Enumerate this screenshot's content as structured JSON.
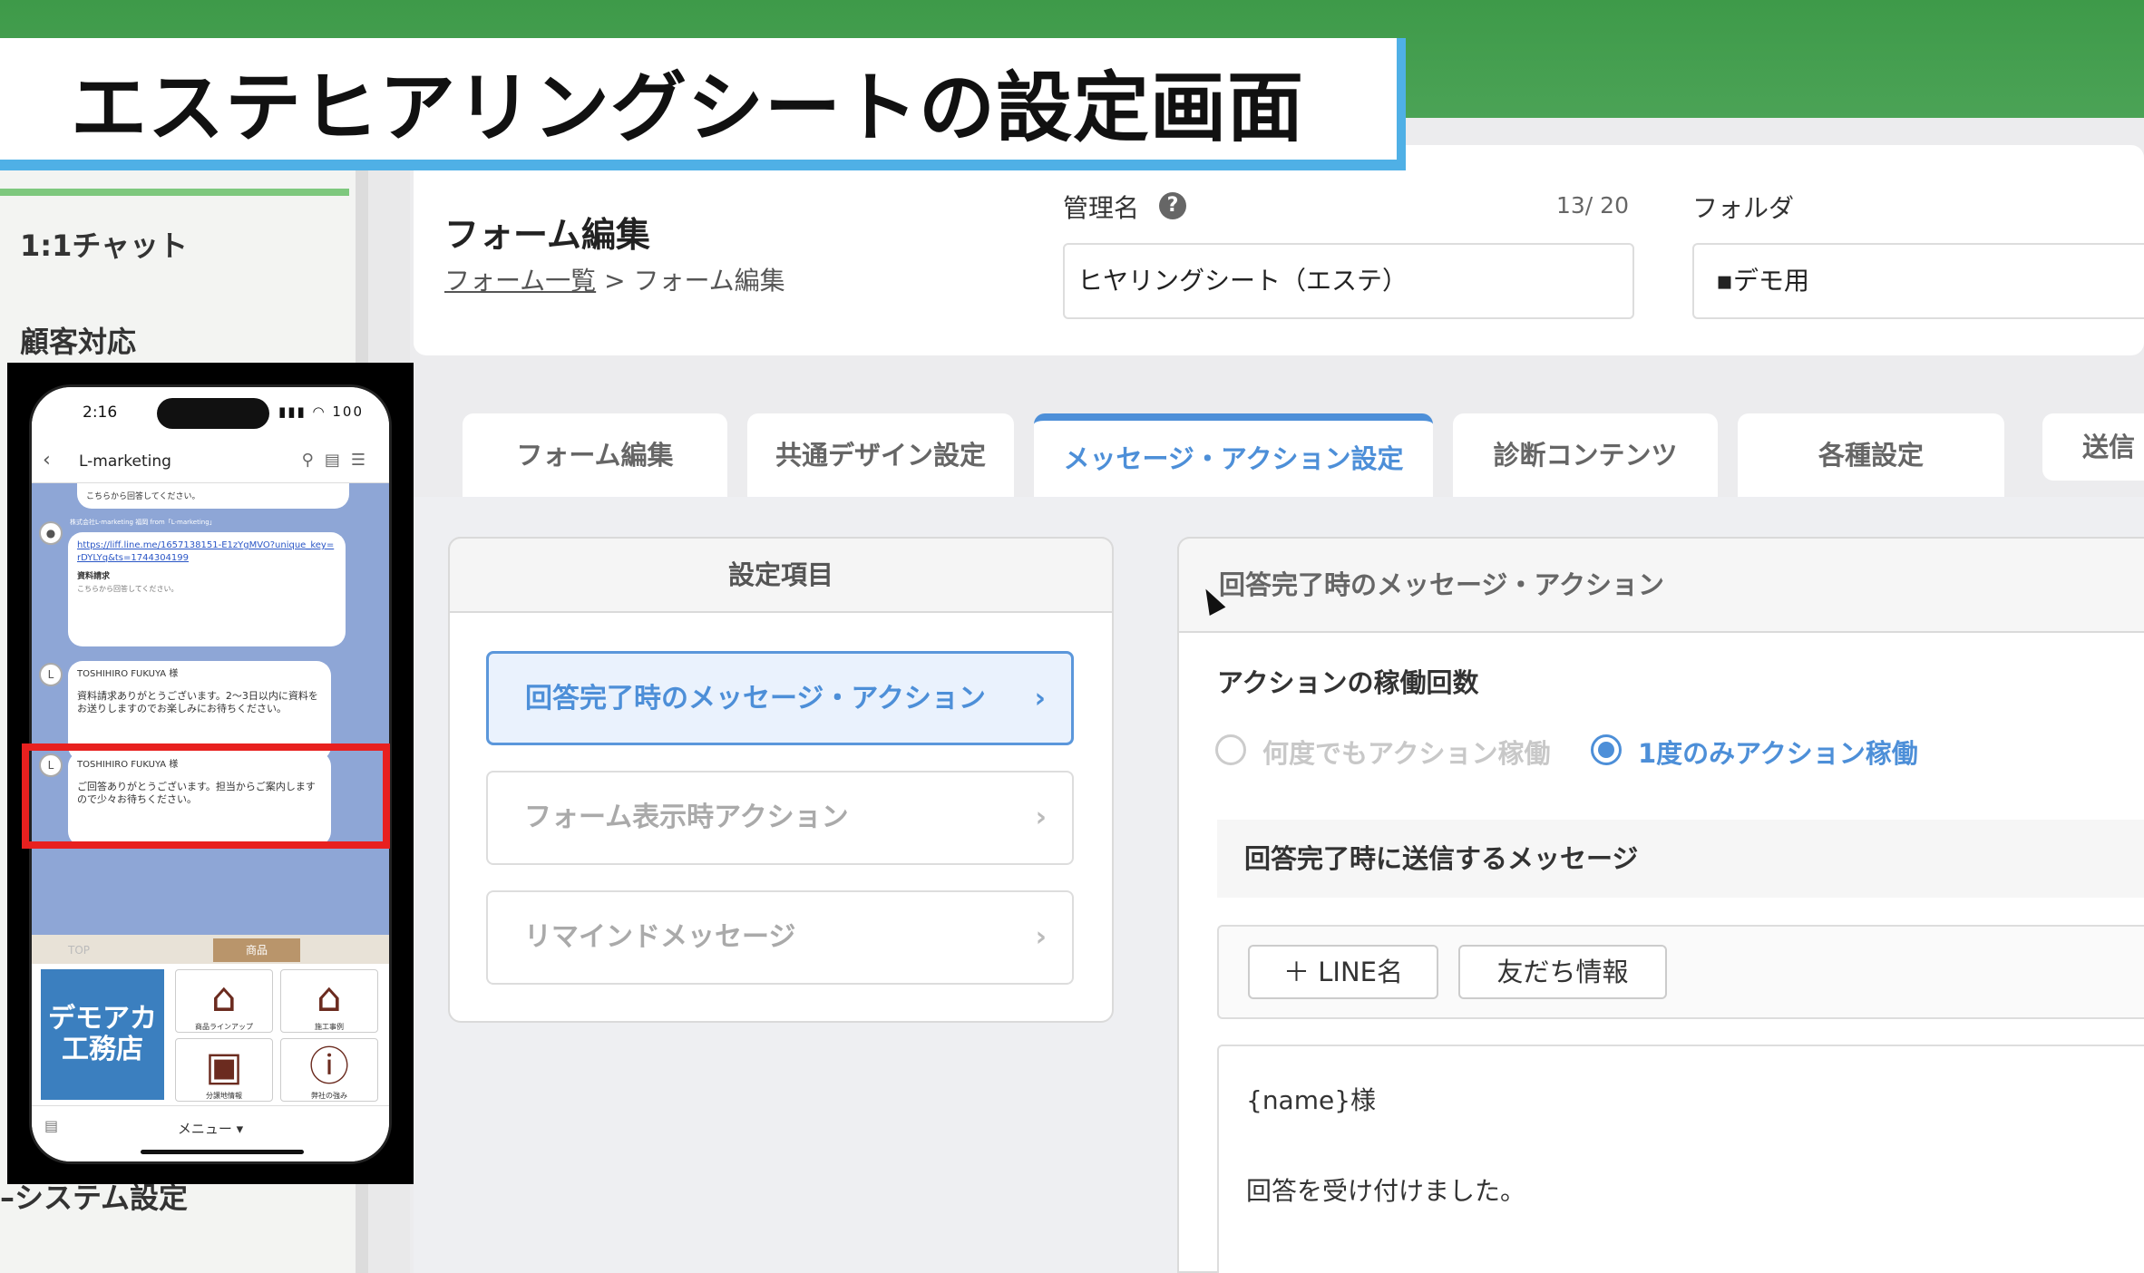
{
  "overlay": {
    "title": "エステヒアリングシートの設定画面"
  },
  "sidebar": {
    "items": [
      {
        "label": "1:1チャット"
      },
      {
        "label": "顧客対応"
      }
    ],
    "bottom_item": "システム設定"
  },
  "phone": {
    "time": "2:16",
    "status_icons": "▮▮▮ ◠ 100",
    "nav_title": "L-marketing",
    "chat": {
      "bubble_top": "こちらから回答してください。",
      "sender_line": "株式会社L-marketing 福岡 from「L-marketing」",
      "link": "https://liff.line.me/1657138151-E1zYgMVO?unique_key=rDYLYq&ts=1744304199",
      "link_card_title": "資料請求",
      "link_card_sub": "こちらから回答してください。",
      "msg1_name": "TOSHIHIRO FUKUYA 様",
      "msg1_body": "資料請求ありがとうございます。2〜3日以内に資料をお送りしますのでお楽しみにお待ちください。",
      "msg2_name": "TOSHIHIRO FUKUYA 様",
      "msg2_body": "ご回答ありがとうございます。担当からご案内しますので少々お待ちください。"
    },
    "rich_tabs": [
      "TOP",
      "",
      "商品",
      ""
    ],
    "rich_menu": {
      "banner": "デモアカ工務店",
      "tiles": [
        {
          "label": "商品ラインアップ",
          "icon": "house-plus-icon"
        },
        {
          "label": "施工事例",
          "icon": "house-icon"
        },
        {
          "label": "分譲地情報",
          "icon": "map-icon"
        },
        {
          "label": "弊社の強み",
          "icon": "info-icon"
        }
      ]
    },
    "menu_label": "メニュー ▾"
  },
  "header": {
    "page_title": "フォーム編集",
    "breadcrumb_link": "フォーム一覧",
    "breadcrumb_sep": " > ",
    "breadcrumb_current": "フォーム編集",
    "mgmt_label": "管理名",
    "mgmt_count": "13/ 20",
    "mgmt_value": "ヒヤリングシート（エステ）",
    "folder_label": "フォルダ",
    "folder_value": "▪デモ用"
  },
  "tabs": [
    {
      "label": "フォーム編集",
      "active": false
    },
    {
      "label": "共通デザイン設定",
      "active": false
    },
    {
      "label": "メッセージ・アクション設定",
      "active": true
    },
    {
      "label": "診断コンテンツ",
      "active": false
    },
    {
      "label": "各種設定",
      "active": false
    },
    {
      "label": "送信",
      "active": false
    }
  ],
  "settings_panel": {
    "title": "設定項目",
    "items": [
      {
        "label": "回答完了時のメッセージ・アクション",
        "active": true
      },
      {
        "label": "フォーム表示時アクション",
        "active": false
      },
      {
        "label": "リマインドメッセージ",
        "active": false
      }
    ]
  },
  "detail_panel": {
    "title": "回答完了時のメッセージ・アクション",
    "action_count_label": "アクションの稼働回数",
    "radio_options": [
      {
        "label": "何度でもアクション稼働",
        "selected": false
      },
      {
        "label": "1度のみアクション稼働",
        "selected": true
      }
    ],
    "message_section_title": "回答完了時に送信するメッセージ",
    "insert_buttons": [
      "＋ LINE名",
      "友だち情報"
    ],
    "message_lines": [
      "{name}様",
      "回答を受け付けました。"
    ]
  },
  "colors": {
    "accent": "#4d8fd8",
    "top_green": "#3e9a49",
    "banner_border": "#4fb0e6",
    "highlight_red": "#e8201f"
  }
}
